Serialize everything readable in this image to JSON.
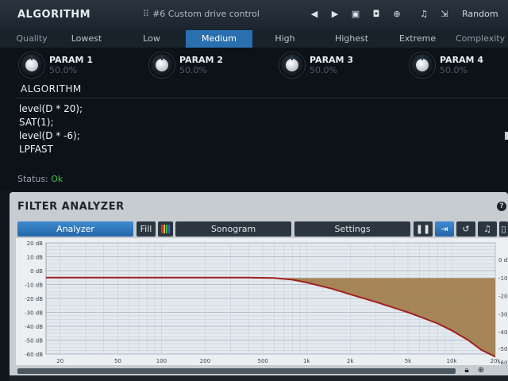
{
  "header": {
    "title": "ALGORITHM",
    "preset_label": "#6 Custom drive control",
    "random_label": "Random"
  },
  "quality": {
    "label": "Quality",
    "options": [
      "Lowest",
      "Low",
      "Medium",
      "High",
      "Highest",
      "Extreme"
    ],
    "selected": "Medium",
    "complexity_label": "Complexity"
  },
  "params": [
    {
      "name": "PARAM 1",
      "value": "50.0%"
    },
    {
      "name": "PARAM 2",
      "value": "50.0%"
    },
    {
      "name": "PARAM 3",
      "value": "50.0%"
    },
    {
      "name": "PARAM 4",
      "value": "50.0%"
    }
  ],
  "code": {
    "title": "ALGORITHM",
    "lines": [
      "level(D * 20);",
      "SAT(1);",
      "level(D * -6);",
      "LPFAST"
    ]
  },
  "status": {
    "label": "Status:",
    "value": "Ok"
  },
  "analyzer": {
    "title": "FILTER ANALYZER",
    "help_label": "?",
    "buttons": {
      "analyzer": "Analyzer",
      "fill": "Fill",
      "sonogram": "Sonogram",
      "settings": "Settings"
    }
  },
  "chart_data": {
    "type": "line",
    "x_scale": "log",
    "xlim": [
      16,
      20000
    ],
    "x_ticks": [
      "20",
      "50",
      "100",
      "200",
      "500",
      "1k",
      "2k",
      "5k",
      "10k",
      "20k"
    ],
    "x_tick_values": [
      20,
      50,
      100,
      200,
      500,
      1000,
      2000,
      5000,
      10000,
      20000
    ],
    "ylim": [
      -60,
      20
    ],
    "y_ticks_left": [
      "20 dB",
      "10 dB",
      "0 dB",
      "-10 dB",
      "-20 dB",
      "-30 dB",
      "-40 dB",
      "-50 dB",
      "-60 dB"
    ],
    "y_tick_values": [
      20,
      10,
      0,
      -10,
      -20,
      -30,
      -40,
      -50,
      -60
    ],
    "y_ticks_right": [
      "0 dB",
      "-10 dB",
      "-20 dB",
      "-30 dB",
      "-40 dB",
      "-50 dB",
      "-60 dB"
    ],
    "grid": true,
    "series": [
      {
        "x": [
          16,
          50,
          100,
          200,
          400,
          600,
          800,
          1000,
          1500,
          2000,
          3000,
          5000,
          8000,
          10000,
          13000,
          16000,
          20000
        ],
        "y": [
          -5,
          -5,
          -5,
          -5,
          -5,
          -5.3,
          -6.5,
          -8.5,
          -13,
          -17,
          -22.5,
          -30,
          -38,
          -43,
          -50,
          -57,
          -62
        ],
        "color": "#a02020"
      }
    ],
    "fill_color": "#9e7a48"
  }
}
